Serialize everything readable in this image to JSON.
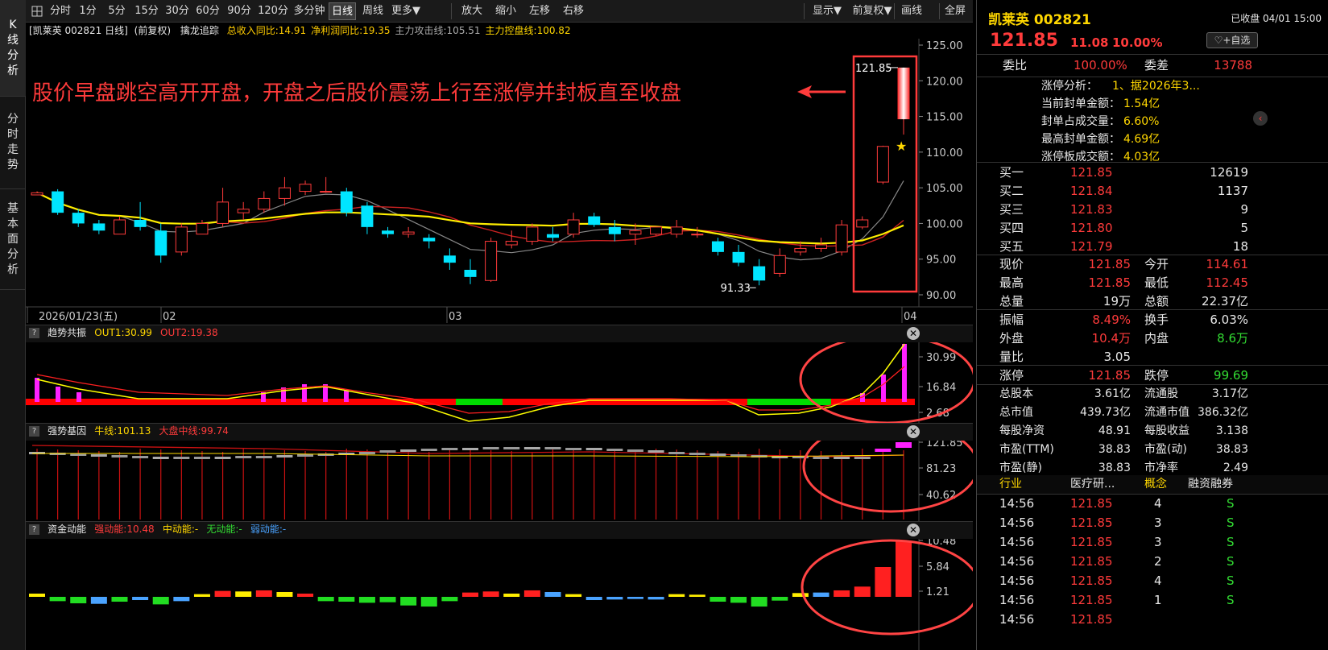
{
  "left_tabs": [
    "K线分析",
    "分时走势",
    "基本面分析"
  ],
  "toolbar": {
    "periods": [
      "分时",
      "1分",
      "5分",
      "15分",
      "30分",
      "60分",
      "90分",
      "120分",
      "多分钟",
      "日线",
      "周线",
      "更多▼"
    ],
    "active_period": "日线",
    "actions": [
      "放大",
      "缩小",
      "左移",
      "右移"
    ],
    "right": [
      "显示▼",
      "前复权▼",
      "画线",
      "全屏"
    ]
  },
  "main_info": {
    "stock": "[凯莱英 002821 日线]",
    "adjust": "(前复权)",
    "indicator": "擒龙追踪",
    "items": [
      {
        "text": "总收入同比:14.91",
        "color": "#ffcc00"
      },
      {
        "text": "净利润同比:19.35",
        "color": "#ffcc00"
      },
      {
        "text": "主力攻击线:105.51",
        "color": "#aaaaaa"
      },
      {
        "text": "主力控盘线:100.82",
        "color": "#ffd700"
      }
    ]
  },
  "main_chart": {
    "y_ticks": [
      "125.00",
      "120.00",
      "115.00",
      "110.00",
      "105.00",
      "100.00",
      "95.00",
      "90.00"
    ],
    "x_labels": [
      "2026/01/23(五)",
      "02",
      "03",
      "04"
    ],
    "annotation": "股价早盘跳空高开开盘，开盘之后股价震荡上行至涨停并封板直至收盘",
    "high_label": "121.85",
    "low_label": "91.33",
    "colors": {
      "up": "#ff3b3b",
      "down": "#00e5ff",
      "ma1": "#ffee00",
      "ma2": "#cc2222",
      "ma3": "#888888"
    }
  },
  "chart_data": [
    {
      "type": "candlestick",
      "title": "凯莱英 002821 日线",
      "ylim": [
        90,
        125
      ],
      "ohlc": [
        [
          104,
          104.5,
          104,
          104.3
        ],
        [
          104.5,
          104.8,
          101.2,
          101.5
        ],
        [
          101.5,
          102,
          99.5,
          100
        ],
        [
          100,
          100.5,
          98.5,
          99
        ],
        [
          98.5,
          101,
          98.5,
          100.5
        ],
        [
          100.5,
          103,
          99,
          99.5
        ],
        [
          99,
          100,
          94.5,
          95.5
        ],
        [
          96,
          100,
          95.5,
          99.5
        ],
        [
          98.5,
          100.5,
          98.5,
          100
        ],
        [
          100,
          105,
          99.5,
          103
        ],
        [
          101.5,
          103,
          100.5,
          102
        ],
        [
          102,
          104.5,
          101.5,
          103.5
        ],
        [
          103.5,
          106.5,
          102.5,
          105
        ],
        [
          104.5,
          106,
          104,
          105.5
        ],
        [
          104.5,
          106.5,
          104.3,
          104.5
        ],
        [
          104.5,
          105,
          101,
          101.5
        ],
        [
          102.5,
          103,
          98.5,
          99.5
        ],
        [
          99,
          99.5,
          98,
          98.5
        ],
        [
          98.5,
          99.5,
          98,
          98.8
        ],
        [
          98,
          98.5,
          96.5,
          97.5
        ],
        [
          95.5,
          96.5,
          93.5,
          94.5
        ],
        [
          93.5,
          95,
          91.5,
          92.5
        ],
        [
          92,
          98,
          91.8,
          97.5
        ],
        [
          97,
          99,
          96.5,
          97.5
        ],
        [
          97.5,
          100,
          97,
          99.5
        ],
        [
          98.5,
          99.5,
          97.5,
          98
        ],
        [
          98.5,
          101.5,
          98,
          100.5
        ],
        [
          101,
          101.5,
          99.5,
          99.8
        ],
        [
          99.5,
          100.5,
          97.5,
          98.5
        ],
        [
          98.5,
          100,
          97,
          99
        ],
        [
          98.5,
          99.5,
          98.3,
          99.5
        ],
        [
          98.5,
          100.5,
          98,
          99.5
        ],
        [
          98.5,
          99.5,
          98,
          98.5
        ],
        [
          97.5,
          98,
          95.5,
          96
        ],
        [
          96,
          97,
          94,
          94.5
        ],
        [
          94,
          95,
          91.33,
          92
        ],
        [
          93,
          96.5,
          92.5,
          95.5
        ],
        [
          96,
          97.5,
          95.5,
          96.5
        ],
        [
          96.5,
          98,
          96,
          97
        ],
        [
          96,
          100.5,
          95.5,
          99.8
        ],
        [
          99.5,
          101,
          99.2,
          100.5
        ],
        [
          105.8,
          110.9,
          105.5,
          110.8
        ],
        [
          114.61,
          121.85,
          112.45,
          121.85
        ]
      ]
    },
    {
      "type": "line+bar",
      "title": "趋势共振",
      "series": [
        {
          "name": "OUT1",
          "value": 30.99
        },
        {
          "name": "OUT2",
          "value": 19.38
        }
      ],
      "ylim": [
        0,
        33
      ],
      "y_ticks": [
        "30.99",
        "16.84",
        "2.68"
      ]
    },
    {
      "type": "bar",
      "title": "强势基因",
      "series": [
        {
          "name": "牛线",
          "value": 101.13
        },
        {
          "name": "大盘中线",
          "value": 99.74
        }
      ],
      "y_ticks": [
        "121.85",
        "81.23",
        "40.62"
      ]
    },
    {
      "type": "bar",
      "title": "资金动能",
      "series": [
        {
          "name": "强动能",
          "value": 10.48
        },
        {
          "name": "中动能",
          "value": "-"
        },
        {
          "name": "无动能",
          "value": "-"
        },
        {
          "name": "弱动能",
          "value": "-"
        }
      ],
      "y_ticks": [
        "10.48",
        "5.84",
        "1.21"
      ],
      "values": [
        0.3,
        -0.5,
        -0.9,
        -1.0,
        -0.6,
        -0.3,
        -1.1,
        -0.5,
        0.2,
        0.8,
        0.7,
        0.9,
        0.6,
        0.3,
        -0.5,
        -0.6,
        -0.8,
        -0.7,
        -1.3,
        -1.5,
        -0.5,
        0.5,
        0.7,
        0.3,
        0.9,
        0.6,
        0.2,
        -0.3,
        -0.2,
        -0.1,
        -0.2,
        0.2,
        0.1,
        -0.6,
        -0.8,
        -1.5,
        -0.4,
        0.4,
        0.5,
        0.9,
        1.6,
        5.5,
        10.48
      ]
    }
  ],
  "sub1": {
    "title": "趋势共振",
    "out1": "OUT1:30.99",
    "out2": "OUT2:19.38",
    "ticks": [
      "30.99",
      "16.84",
      "2.68"
    ]
  },
  "sub2": {
    "title": "强势基因",
    "bull": "牛线:101.13",
    "mid": "大盘中线:99.74",
    "ticks": [
      "121.85",
      "81.23",
      "40.62"
    ]
  },
  "sub3": {
    "title": "资金动能",
    "strong": "强动能:10.48",
    "mid": "中动能:-",
    "none": "无动能:-",
    "weak": "弱动能:-",
    "ticks": [
      "10.48",
      "5.84",
      "1.21"
    ]
  },
  "right_panel": {
    "name": "凯莱英 002821",
    "status": "已收盘 04/01 15:00",
    "price": "121.85",
    "change": "11.08",
    "pct": "10.00%",
    "fav": "+自选",
    "weibi_label": "委比",
    "weibi": "100.00%",
    "weicha_label": "委差",
    "weicha": "13788",
    "limit": [
      {
        "label": "涨停分析：",
        "value": "1、据2026年3..."
      },
      {
        "label": "当前封单金额：",
        "value": "1.54亿"
      },
      {
        "label": "封单占成交量：",
        "value": "6.60%"
      },
      {
        "label": "最高封单金额：",
        "value": "4.69亿"
      },
      {
        "label": "涨停板成交额：",
        "value": "4.03亿"
      }
    ],
    "bids": [
      {
        "label": "买一",
        "price": "121.85",
        "vol": "12619"
      },
      {
        "label": "买二",
        "price": "121.84",
        "vol": "1137"
      },
      {
        "label": "买三",
        "price": "121.83",
        "vol": "9"
      },
      {
        "label": "买四",
        "price": "121.80",
        "vol": "5"
      },
      {
        "label": "买五",
        "price": "121.79",
        "vol": "18"
      }
    ],
    "quote1": [
      {
        "l1": "现价",
        "v1": "121.85",
        "c1": "red",
        "l2": "今开",
        "v2": "114.61",
        "c2": "red"
      },
      {
        "l1": "最高",
        "v1": "121.85",
        "c1": "red",
        "l2": "最低",
        "v2": "112.45",
        "c2": "red"
      },
      {
        "l1": "总量",
        "v1": "19万",
        "c1": "white",
        "l2": "总额",
        "v2": "22.37亿",
        "c2": "white"
      }
    ],
    "quote2": [
      {
        "l1": "振幅",
        "v1": "8.49%",
        "c1": "red",
        "l2": "换手",
        "v2": "6.03%",
        "c2": "white"
      },
      {
        "l1": "外盘",
        "v1": "10.4万",
        "c1": "red",
        "l2": "内盘",
        "v2": "8.6万",
        "c2": "green"
      },
      {
        "l1": "量比",
        "v1": "3.05",
        "c1": "white",
        "l2": "",
        "v2": "",
        "c2": "white"
      }
    ],
    "quote3": [
      {
        "l1": "涨停",
        "v1": "121.85",
        "c1": "red",
        "l2": "跌停",
        "v2": "99.69",
        "c2": "green"
      }
    ],
    "fund": [
      {
        "l1": "总股本",
        "v1": "3.61亿",
        "l2": "流通股",
        "v2": "3.17亿"
      },
      {
        "l1": "总市值",
        "v1": "439.73亿",
        "l2": "流通市值",
        "v2": "386.32亿"
      },
      {
        "l1": "每股净资",
        "v1": "48.91",
        "l2": "每股收益",
        "v2": "3.138"
      },
      {
        "l1": "市盈(TTM)",
        "v1": "38.83",
        "l2": "市盈(动)",
        "v2": "38.83"
      },
      {
        "l1": "市盈(静)",
        "v1": "38.83",
        "l2": "市净率",
        "v2": "2.49"
      }
    ],
    "tags": {
      "industry": "行业",
      "industry_val": "医疗研...",
      "concept": "概念",
      "margin": "融资融券"
    },
    "trades": [
      {
        "time": "14:56",
        "price": "121.85",
        "vol": "4",
        "side": "S"
      },
      {
        "time": "14:56",
        "price": "121.85",
        "vol": "3",
        "side": "S"
      },
      {
        "time": "14:56",
        "price": "121.85",
        "vol": "3",
        "side": "S"
      },
      {
        "time": "14:56",
        "price": "121.85",
        "vol": "2",
        "side": "S"
      },
      {
        "time": "14:56",
        "price": "121.85",
        "vol": "4",
        "side": "S"
      },
      {
        "time": "14:56",
        "price": "121.85",
        "vol": "1",
        "side": "S"
      },
      {
        "time": "14:56",
        "price": "121.85",
        "vol": "",
        "side": ""
      }
    ]
  }
}
